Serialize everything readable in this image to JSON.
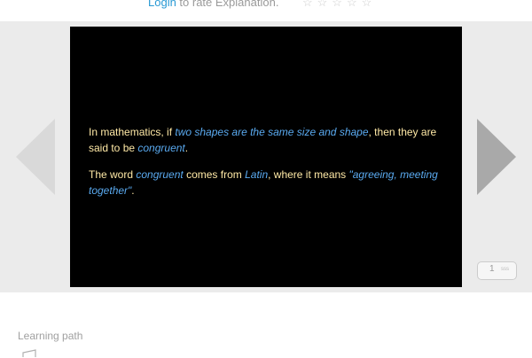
{
  "rating": {
    "login_label": "Login",
    "prompt": " to rate Explanation.",
    "stars": "☆☆☆☆☆"
  },
  "slide": {
    "para1": {
      "t1": "In mathematics, if ",
      "h1": "two shapes are the same size and shape",
      "t2": ", then they are said to be ",
      "h2": "congruent",
      "t3": "."
    },
    "para2": {
      "t1": "The word ",
      "h1": "congruent",
      "t2": " comes from ",
      "h2": "Latin",
      "t3": ", where it means ",
      "h3": "\"agreeing, meeting together\"",
      "t4": "."
    },
    "colors": {
      "background": "#000000",
      "text": "#ffe9a6",
      "highlight": "#5aaaf0"
    }
  },
  "pager": {
    "current": "1",
    "secondary": "sss"
  },
  "learning_path": {
    "label": "Learning path"
  },
  "icons": [
    "star-icon",
    "arrow-left-icon",
    "arrow-right-icon",
    "learning-path-icon"
  ]
}
